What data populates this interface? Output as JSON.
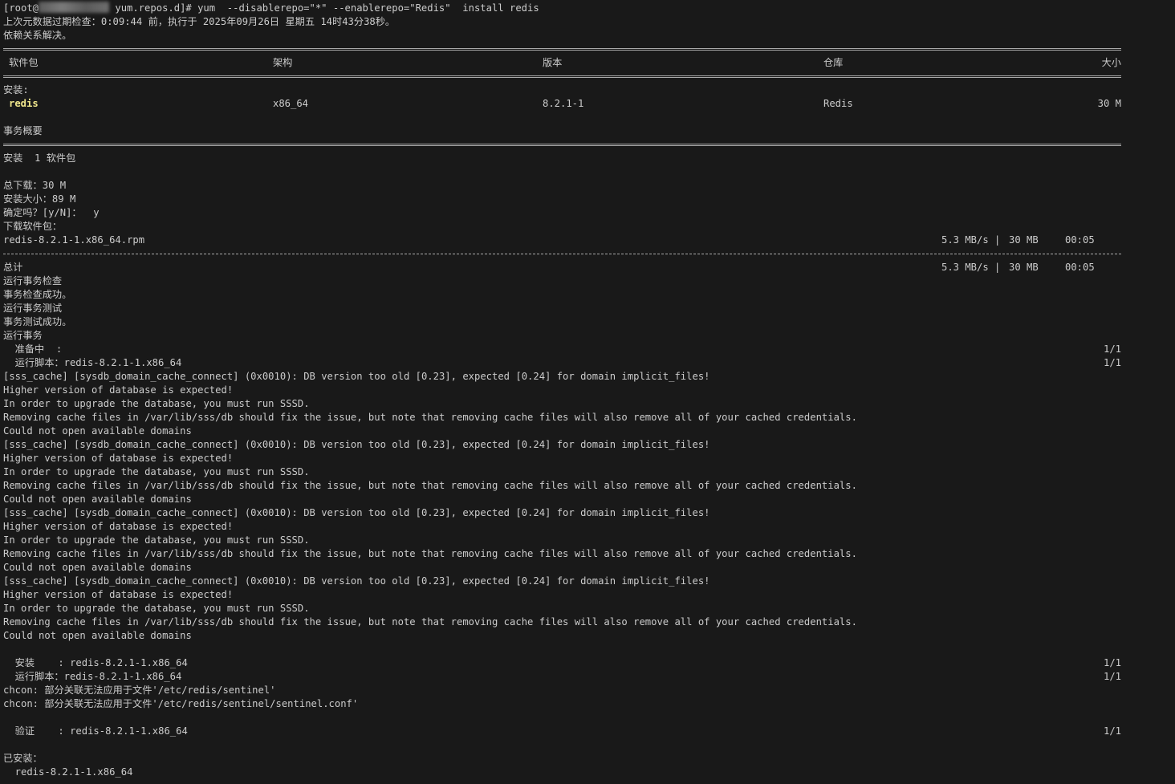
{
  "prompt": {
    "user_prefix": "[root@",
    "path_suffix": " yum.repos.d]# ",
    "command": "yum  --disablerepo=\"*\" --enablerepo=\"Redis\"  install redis"
  },
  "meta_check": "上次元数据过期检查：0:09:44 前，执行于 2025年09月26日 星期五 14时43分38秒。",
  "deps_resolved": "依赖关系解决。",
  "table": {
    "headers": {
      "package": "软件包",
      "arch": "架构",
      "version": "版本",
      "repo": "仓库",
      "size": "大小"
    },
    "section_install": "安装:",
    "row": {
      "package": "redis",
      "arch": "x86_64",
      "version": "8.2.1-1",
      "repo": "Redis",
      "size": "30 M"
    }
  },
  "summary": {
    "title": "事务概要",
    "install_line": "安装  1 软件包",
    "total_download": "总下载：30 M",
    "install_size": "安装大小：89 M",
    "confirm": "确定吗？[y/N]：  y",
    "downloading": "下载软件包："
  },
  "download": {
    "file": "redis-8.2.1-1.x86_64.rpm",
    "rate": "5.3 MB/s |",
    "size": "30 MB",
    "eta": "00:05"
  },
  "total": {
    "label": "总计",
    "rate": "5.3 MB/s |",
    "size": "30 MB",
    "eta": "00:05"
  },
  "transaction": {
    "check": "运行事务检查",
    "check_ok": "事务检查成功。",
    "test": "运行事务测试",
    "test_ok": "事务测试成功。",
    "run": "运行事务",
    "preparing": "  准备中  :",
    "preparing_count": "1/1",
    "scriptlet1": "  运行脚本：redis-8.2.1-1.x86_64",
    "scriptlet1_count": "1/1"
  },
  "sss_errors": [
    {
      "l1": "[sss_cache] [sysdb_domain_cache_connect] (0x0010): DB version too old [0.23], expected [0.24] for domain implicit_files!",
      "l2": "Higher version of database is expected!",
      "l3": "In order to upgrade the database, you must run SSSD.",
      "l4": "Removing cache files in /var/lib/sss/db should fix the issue, but note that removing cache files will also remove all of your cached credentials.",
      "l5": "Could not open available domains"
    },
    {
      "l1": "[sss_cache] [sysdb_domain_cache_connect] (0x0010): DB version too old [0.23], expected [0.24] for domain implicit_files!",
      "l2": "Higher version of database is expected!",
      "l3": "In order to upgrade the database, you must run SSSD.",
      "l4": "Removing cache files in /var/lib/sss/db should fix the issue, but note that removing cache files will also remove all of your cached credentials.",
      "l5": "Could not open available domains"
    },
    {
      "l1": "[sss_cache] [sysdb_domain_cache_connect] (0x0010): DB version too old [0.23], expected [0.24] for domain implicit_files!",
      "l2": "Higher version of database is expected!",
      "l3": "In order to upgrade the database, you must run SSSD.",
      "l4": "Removing cache files in /var/lib/sss/db should fix the issue, but note that removing cache files will also remove all of your cached credentials.",
      "l5": "Could not open available domains"
    },
    {
      "l1": "[sss_cache] [sysdb_domain_cache_connect] (0x0010): DB version too old [0.23], expected [0.24] for domain implicit_files!",
      "l2": "Higher version of database is expected!",
      "l3": "In order to upgrade the database, you must run SSSD.",
      "l4": "Removing cache files in /var/lib/sss/db should fix the issue, but note that removing cache files will also remove all of your cached credentials.",
      "l5": "Could not open available domains"
    }
  ],
  "post": {
    "installing": "  安装    : redis-8.2.1-1.x86_64",
    "installing_count": "1/1",
    "scriptlet2": "  运行脚本：redis-8.2.1-1.x86_64",
    "scriptlet2_count": "1/1",
    "chcon1": "chcon: 部分关联无法应用于文件'/etc/redis/sentinel'",
    "chcon2": "chcon: 部分关联无法应用于文件'/etc/redis/sentinel/sentinel.conf'",
    "verifying": "  验证    : redis-8.2.1-1.x86_64",
    "verifying_count": "1/1",
    "installed_title": "已安装：",
    "installed_pkg": "  redis-8.2.1-1.x86_64"
  }
}
